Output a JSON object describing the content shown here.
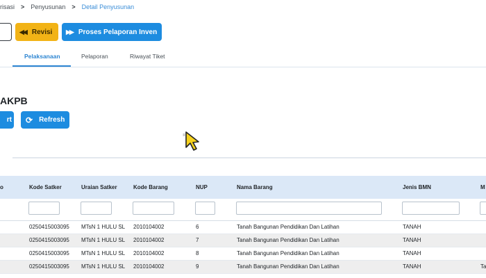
{
  "breadcrumb": {
    "items": [
      "risasi",
      "Penyusunan",
      "Detail Penyusunan"
    ],
    "separator": ">"
  },
  "toolbar": {
    "revisi_label": "Revisi",
    "proses_label": "Proses Pelaporan Inven"
  },
  "tabs": [
    {
      "label": "Pelaksanaan",
      "active": true
    },
    {
      "label": "Pelaporan",
      "active": false
    },
    {
      "label": "Riwayat Tiket",
      "active": false
    }
  ],
  "section": {
    "title": "AKPB",
    "export_label": "rt",
    "refresh_label": "Refresh"
  },
  "table": {
    "columns": [
      "Kode Satker",
      "Uraian Satker",
      "Kode Barang",
      "NUP",
      "Nama Barang",
      "Jenis BMN",
      "M"
    ],
    "rows": [
      [
        "0250415003095",
        "MTsN 1 HULU SL",
        "2010104002",
        "6",
        "Tanah Bangunan Pendidikan Dan Latihan",
        "TANAH",
        ""
      ],
      [
        "0250415003095",
        "MTsN 1 HULU SL",
        "2010104002",
        "7",
        "Tanah Bangunan Pendidikan Dan Latihan",
        "TANAH",
        ""
      ],
      [
        "0250415003095",
        "MTsN 1 HULU SL",
        "2010104002",
        "8",
        "Tanah Bangunan Pendidikan Dan Latihan",
        "TANAH",
        ""
      ],
      [
        "0250415003095",
        "MTsN 1 HULU SL",
        "2010104002",
        "9",
        "Tanah Bangunan Pendidikan Dan Latihan",
        "TANAH",
        "Ta"
      ]
    ]
  },
  "colors": {
    "primary": "#1d8ce0",
    "warning": "#f2b316",
    "header_bg": "#dbe8f7",
    "active_tab": "#2e86d2"
  }
}
